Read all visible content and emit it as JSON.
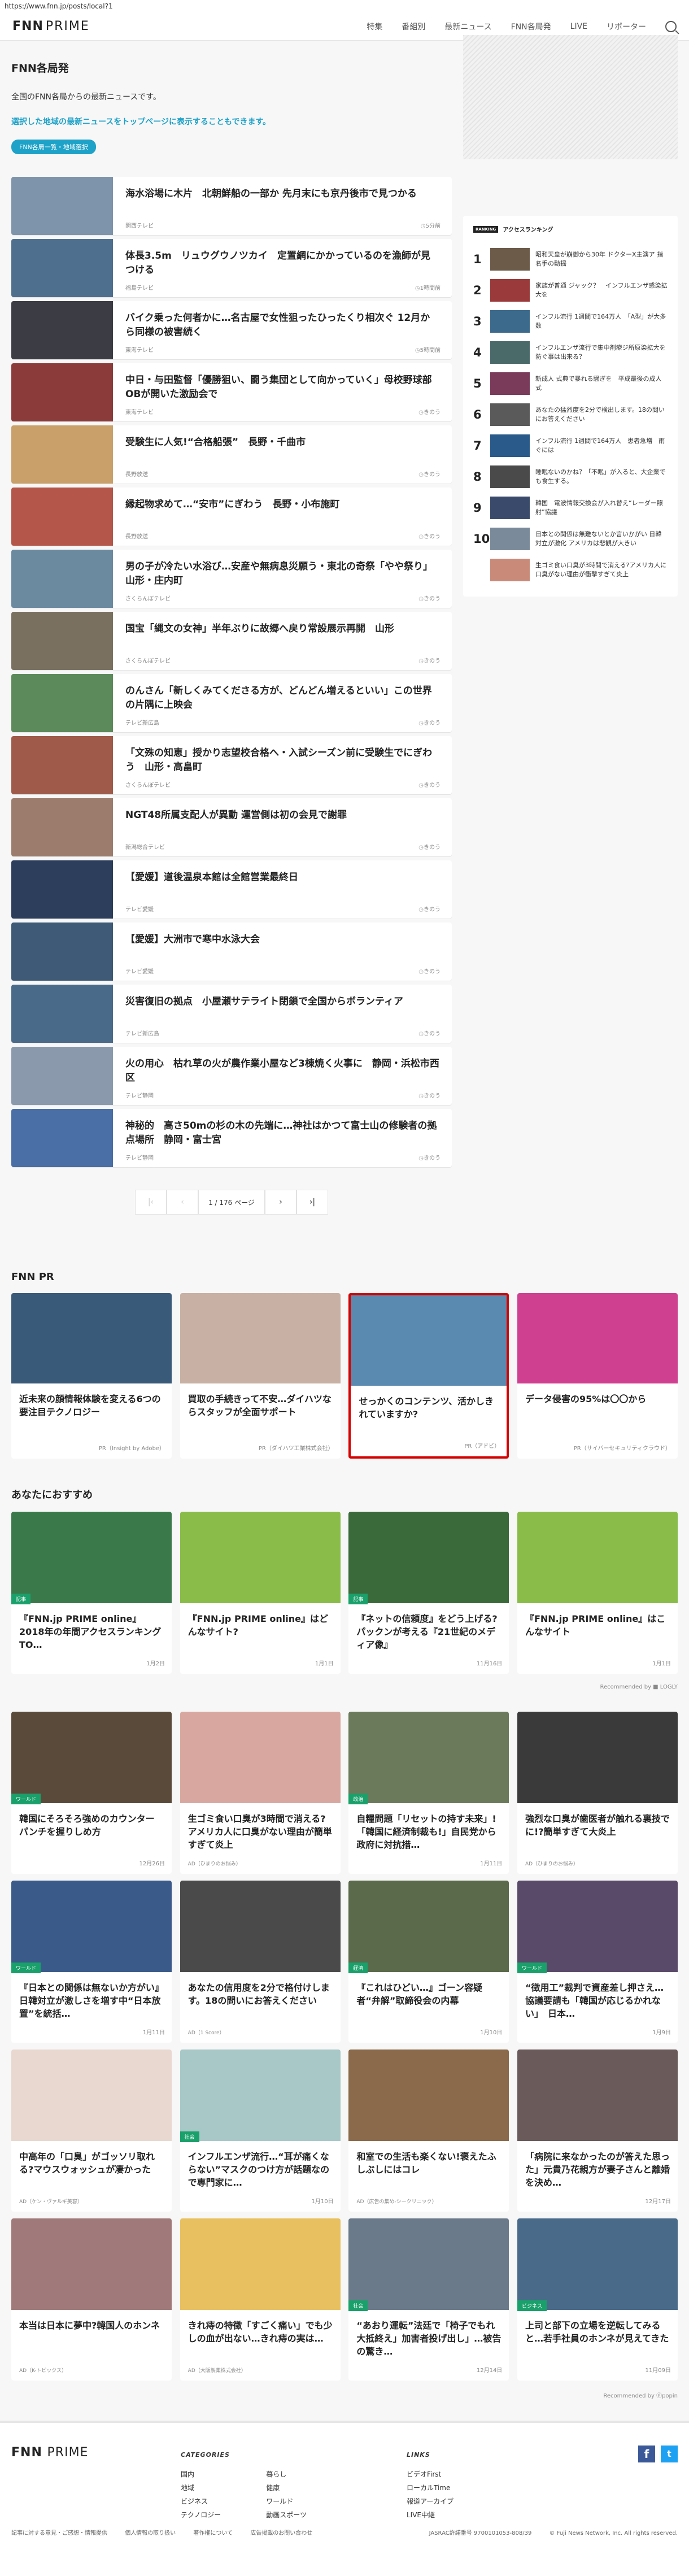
{
  "url": "https://www.fnn.jp/posts/local?1",
  "header": {
    "logo_main": "FNN",
    "logo_sub": "PRIME",
    "nav": [
      "特集",
      "番組別",
      "最新ニュース",
      "FNN各局発",
      "LIVE",
      "リポーター"
    ]
  },
  "page": {
    "title": "FNN各局発",
    "description": "全国のFNN各局からの最新ニュースです。",
    "link": "選択した地域の最新ニュースをトップページに表示することもできます。",
    "badge": "FNN各局一覧・地域選択"
  },
  "articles": [
    {
      "title": "海水浴場に木片　北朝鮮船の一部か 先月末にも京丹後市で見つかる",
      "source": "関西テレビ",
      "time": "5分前",
      "color": "#7d94aa"
    },
    {
      "title": "体長3.5m　リュウグウノツカイ　定置網にかかっているのを漁師が見つける",
      "source": "福島テレビ",
      "time": "1時間前",
      "color": "#4f6f8f"
    },
    {
      "title": "バイク乗った何者かに…名古屋で女性狙ったひったくり相次ぐ 12月から同様の被害続く",
      "source": "東海テレビ",
      "time": "5時間前",
      "color": "#3c3c44"
    },
    {
      "title": "中日・与田監督「優勝狙い、闘う集団として向かっていく」母校野球部OBが開いた激励会で",
      "source": "東海テレビ",
      "time": "きのう",
      "color": "#8c3b3b"
    },
    {
      "title": "受験生に人気!“合格船張”　長野・千曲市",
      "source": "長野放送",
      "time": "きのう",
      "color": "#c9a06a"
    },
    {
      "title": "縁起物求めて…“安市”にぎわう　長野・小布施町",
      "source": "長野放送",
      "time": "きのう",
      "color": "#b4564a"
    },
    {
      "title": "男の子が冷たい水浴び…安産や無病息災願う・東北の奇祭「やや祭り」 山形・庄内町",
      "source": "さくらんぼテレビ",
      "time": "きのう",
      "color": "#6b8aa0"
    },
    {
      "title": "国宝「縄文の女神」半年ぶりに故郷へ戻り常設展示再開　山形",
      "source": "さくらんぼテレビ",
      "time": "きのう",
      "color": "#7a7060"
    },
    {
      "title": "のんさん「新しくみてくださる方が、どんどん増えるといい」この世界の片隅に上映会",
      "source": "テレビ新広島",
      "time": "きのう",
      "color": "#5d8a5a"
    },
    {
      "title": "「文殊の知恵」授かり志望校合格へ・入試シーズン前に受験生でにぎわう　山形・高畠町",
      "source": "さくらんぼテレビ",
      "time": "きのう",
      "color": "#a05a4a"
    },
    {
      "title": "NGT48所属支配人が異動 運営側は初の会見で謝罪",
      "source": "新潟総合テレビ",
      "time": "きのう",
      "color": "#9c7c6c"
    },
    {
      "title": "【愛媛】道後温泉本館は全館営業最終日",
      "source": "テレビ愛媛",
      "time": "きのう",
      "color": "#2c3e5c"
    },
    {
      "title": "【愛媛】大洲市で寒中水泳大会",
      "source": "テレビ愛媛",
      "time": "きのう",
      "color": "#3e5a76"
    },
    {
      "title": "災害復旧の拠点　小屋瀬サテライト閉鎖で全国からボランティア",
      "source": "テレビ新広島",
      "time": "きのう",
      "color": "#4a6a8a"
    },
    {
      "title": "火の用心　枯れ草の火が農作業小屋など3棟焼く火事に　静岡・浜松市西区",
      "source": "テレビ静岡",
      "time": "きのう",
      "color": "#8a9aac"
    },
    {
      "title": "神秘的　高さ50mの杉の木の先端に…神社はかつて富士山の修験者の拠点場所　静岡・富士宮",
      "source": "テレビ静岡",
      "time": "きのう",
      "color": "#4a6ea6"
    }
  ],
  "pager": {
    "first": "|‹",
    "prev": "‹",
    "current": "1 / 176 ページ",
    "next": "›",
    "last": "›|"
  },
  "ranking": {
    "tag": "RANKING",
    "title": "アクセスランキング",
    "items": [
      {
        "no": "1",
        "text": "昭和天皇が崩御から30年 ドクターX主演ア 指名手の動揺",
        "color": "#6d5b4a"
      },
      {
        "no": "2",
        "text": "家族が普通 ジャック？　インフルエンザ感染拡大を",
        "color": "#9a3a3a"
      },
      {
        "no": "3",
        "text": "インフル流行 1週間で164万人　「A型」が大多数",
        "color": "#3c6a8c"
      },
      {
        "no": "4",
        "text": "インフルエンザ流行で集中剤療ジ所原染拡大を防ぐ事は出来る？",
        "color": "#4a6a6a"
      },
      {
        "no": "5",
        "text": "新成人 式典で暴れる騒ぎを　平成最後の成人式",
        "color": "#7a3a5a"
      },
      {
        "no": "6",
        "text": "あなたの猛烈度を2分で検出します。18の問いにお答えください",
        "color": "#5a5a5a"
      },
      {
        "no": "7",
        "text": "インフル流行 1週間で164万人　患者急増　雨ぐには",
        "color": "#2a5a8a"
      },
      {
        "no": "8",
        "text": "睡眠ないのかね？「不眠」が入ると、大企業でも食生する。",
        "color": "#4a4a4a"
      },
      {
        "no": "9",
        "text": "韓国　電波情報交換会が入れ替え“レーダー照射”協議",
        "color": "#3a4a6a"
      },
      {
        "no": "10",
        "text": "日本との関係は無難ないとか言いかがい 日韓対立が激化 アメリカは悲観が大きい",
        "color": "#7a8a9a"
      },
      {
        "no": "",
        "text": "生ゴミ食い口臭が3時間で消える?アメリカ人に口臭がない理由が衝撃すぎて炎上",
        "color": "#c98a7a"
      }
    ]
  },
  "pr": {
    "title": "FNN PR",
    "items": [
      {
        "title": "近未来の顔情報体験を変える6つの要注目テクノロジー",
        "sponsor": "PR（Insight by Adobe）",
        "color": "#3a5a7a",
        "highlight": false
      },
      {
        "title": "買取の手続きって不安…ダイハツならスタッフが全面サポート",
        "sponsor": "PR（ダイハツ工業株式会社）",
        "color": "#c8b0a4",
        "highlight": false
      },
      {
        "title": "せっかくのコンテンツ、活かしきれていますか?",
        "sponsor": "PR（アドビ）",
        "color": "#5a8ab0",
        "highlight": true
      },
      {
        "title": "データ侵害の95%は〇〇から",
        "sponsor": "PR（サイバーセキュリティクラウド）",
        "color": "#d04090",
        "highlight": false
      }
    ]
  },
  "recommend": {
    "title": "あなたにおすすめ",
    "items": [
      {
        "title": "『FNN.jp PRIME online』2018年の年間アクセスランキングTO…",
        "meta": "1月2日",
        "label": "記事",
        "color": "#3a7a4a",
        "ad": false
      },
      {
        "title": "『FNN.jp PRIME online』はどんなサイト?",
        "meta": "1月1日",
        "label": "",
        "color": "#8abc4a",
        "ad": false
      },
      {
        "title": "『ネットの信頼度』をどう上げる? パックンが考える『21世紀のメディア像』",
        "meta": "11月16日",
        "label": "記事",
        "color": "#3a6a3a",
        "ad": false
      },
      {
        "title": "『FNN.jp PRIME online』はこんなサイト",
        "meta": "1月1日",
        "label": "",
        "color": "#8abc4a",
        "ad": false
      },
      {
        "title": "韓国にそろそろ強めのカウンターパンチを握りしめ方",
        "meta": "12月26日",
        "label": "ワールド",
        "color": "#5a4a3a",
        "ad": false
      },
      {
        "title": "生ゴミ食い口臭が3時間で消える?アメリカ人に口臭がない理由が簡単すぎて炎上",
        "meta": "AD（ひまりのお悩み）",
        "label": "",
        "color": "#d8a8a0",
        "ad": true
      },
      {
        "title": "自糧問題「リセットの持す未来」!「韓国に経済制裁も!」自民党から政府に対抗措…",
        "meta": "1月11日",
        "label": "政治",
        "color": "#6a7a5a",
        "ad": false
      },
      {
        "title": "強烈な口臭が歯医者が触れる裏技でに!?簡単すぎて大炎上",
        "meta": "AD（ひまりのお悩み）",
        "label": "",
        "color": "#3a3a3a",
        "ad": true
      },
      {
        "title": "『日本との関係は無ないか方がい』日韓対立が激しさを増す中“日本放置”を統括…",
        "meta": "1月11日",
        "label": "ワールド",
        "color": "#3a5a8a",
        "ad": false
      },
      {
        "title": "あなたの信用度を2分で格付けします。18の問いにお答えください",
        "meta": "AD（1 Score）",
        "label": "",
        "color": "#4a4a4a",
        "ad": true
      },
      {
        "title": "『これはひどい…』ゴーン容疑者“弁解”取締役会の内幕",
        "meta": "1月10日",
        "label": "経済",
        "color": "#5a6a4a",
        "ad": false
      },
      {
        "title": "“徴用工”裁判で資産差し押さえ…協議要請も「韓国が応じるかれない」　日本…",
        "meta": "1月9日",
        "label": "ワールド",
        "color": "#5a4a6a",
        "ad": false
      },
      {
        "title": "中高年の「口臭」がゴッソリ取れる?マウスウォッシュが凄かった",
        "meta": "AD（ケン・ヴァルギ美容）",
        "label": "",
        "color": "#e8d8d0",
        "ad": true
      },
      {
        "title": "インフルエンザ流行…“耳が痛くならない”マスクのつけ方が話題なので専門家に…",
        "meta": "1月10日",
        "label": "社会",
        "color": "#a8c8c8",
        "ad": false
      },
      {
        "title": "和室での生活も楽くない!褒えたふしぶしにはコレ",
        "meta": "AD（広告の集め-シークリニック）",
        "label": "",
        "color": "#8a6a4a",
        "ad": true
      },
      {
        "title": "「病院に来なかったのが答えた思った」元貴乃花親方が妻子さんと離婚を決め…",
        "meta": "12月17日",
        "label": "",
        "color": "#6a5a5a",
        "ad": false
      },
      {
        "title": "本当は日本に夢中?韓国人のホンネ",
        "meta": "AD（K-トピックス）",
        "label": "",
        "color": "#a07a7a",
        "ad": true
      },
      {
        "title": "きれ痔の特徴「すごく痛い」でも少しの血が出ない…きれ痔の実は…",
        "meta": "AD（大阪製薬株式会社）",
        "label": "",
        "color": "#e8c060",
        "ad": true
      },
      {
        "title": "“あおり運転”法廷で「椅子でもれ大抵終え」加害者投げ出し」…被告の驚き…",
        "meta": "12月14日",
        "label": "社会",
        "color": "#6a7a8a",
        "ad": false
      },
      {
        "title": "上司と部下の立場を逆転してみると…若手社員のホンネが見えてきた",
        "meta": "11月09日",
        "label": "ビジネス",
        "color": "#4a6a8a",
        "ad": false
      }
    ],
    "recommended_by": "Recommended by ⓟpopin",
    "recommended_by2": "Recommended by ■ LOGLY"
  },
  "footer": {
    "categories_title": "CATEGORIES",
    "categories": [
      [
        "国内",
        "地域",
        "ビジネス",
        "テクノロジー"
      ],
      [
        "暮らし",
        "健康",
        "ワールド",
        "動画スポーツ"
      ]
    ],
    "links_title": "LINKS",
    "links": [
      "ビデオFirst",
      "ローカルTime",
      "報道アーカイブ",
      "LIVE中継"
    ],
    "bottom": [
      "記事に対する意見・ご感想・情報提供",
      "個人情報の取り扱い",
      "著作権について",
      "広告掲載のお問い合わせ"
    ],
    "jasrac": "JASRAC許諾番号 9700101053-808/39",
    "copyright": "© Fuji News Network, Inc. All rights reserved."
  }
}
